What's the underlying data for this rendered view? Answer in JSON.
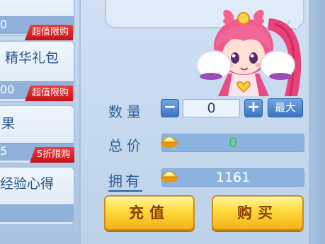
{
  "shop_items": [
    {
      "name": "",
      "price": "0",
      "promo": "超值限购"
    },
    {
      "name": "精华礼包",
      "price": "00",
      "promo": "超值限购"
    },
    {
      "name": "果",
      "price": "5",
      "promo": "5折限购"
    },
    {
      "name": "经验心得",
      "price": "",
      "promo": ""
    }
  ],
  "purchase": {
    "quantity_label": "数量",
    "quantity_value": "0",
    "minus_symbol": "−",
    "plus_symbol": "+",
    "max_label": "最大",
    "total_label": "总价",
    "total_value": "0",
    "owned_label": "拥有",
    "owned_value": "1161"
  },
  "buttons": {
    "recharge": "充值",
    "buy": "购买"
  },
  "colors": {
    "total_value": "#2ec93a",
    "promo": "#d81e24",
    "gold_button": "#ffd93a"
  }
}
